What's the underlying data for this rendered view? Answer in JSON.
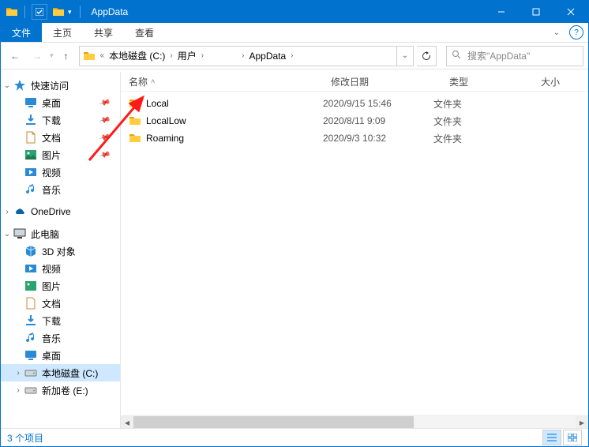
{
  "title": "AppData",
  "ribbon": {
    "file": "文件",
    "tabs": [
      "主页",
      "共享",
      "查看"
    ]
  },
  "breadcrumb": {
    "overflow": "«",
    "segments": [
      "本地磁盘 (C:)",
      "用户",
      "",
      "AppData"
    ],
    "obscured_index": 2
  },
  "search": {
    "placeholder": "搜索\"AppData\""
  },
  "columns": {
    "name": "名称",
    "date": "修改日期",
    "type": "类型",
    "size": "大小"
  },
  "files": [
    {
      "name": "Local",
      "date": "2020/9/15 15:46",
      "type": "文件夹"
    },
    {
      "name": "LocalLow",
      "date": "2020/8/11 9:09",
      "type": "文件夹"
    },
    {
      "name": "Roaming",
      "date": "2020/9/3 10:32",
      "type": "文件夹"
    }
  ],
  "sidebar": {
    "quick": {
      "label": "快速访问",
      "items": [
        "桌面",
        "下载",
        "文档",
        "图片",
        "视频",
        "音乐"
      ]
    },
    "onedrive": {
      "label": "OneDrive"
    },
    "thispc": {
      "label": "此电脑",
      "items": [
        "3D 对象",
        "视频",
        "图片",
        "文档",
        "下载",
        "音乐",
        "桌面",
        "本地磁盘 (C:)",
        "新加卷 (E:)"
      ],
      "selected_index": 7
    }
  },
  "status": {
    "text": "3 个项目"
  },
  "icons": {
    "quick": "#2a8ad4",
    "desktop": "#2a8ad4",
    "download": "#2a8ad4",
    "document": "#c08a3a",
    "picture": "#2aa36f",
    "video": "#2a8ad4",
    "music": "#2a8ad4",
    "onedrive": "#0a64a4",
    "thispc": "#3a3a3a",
    "3d": "#2a8ad4",
    "drive": "#7a7a7a",
    "folder": "#ffcd3f"
  }
}
